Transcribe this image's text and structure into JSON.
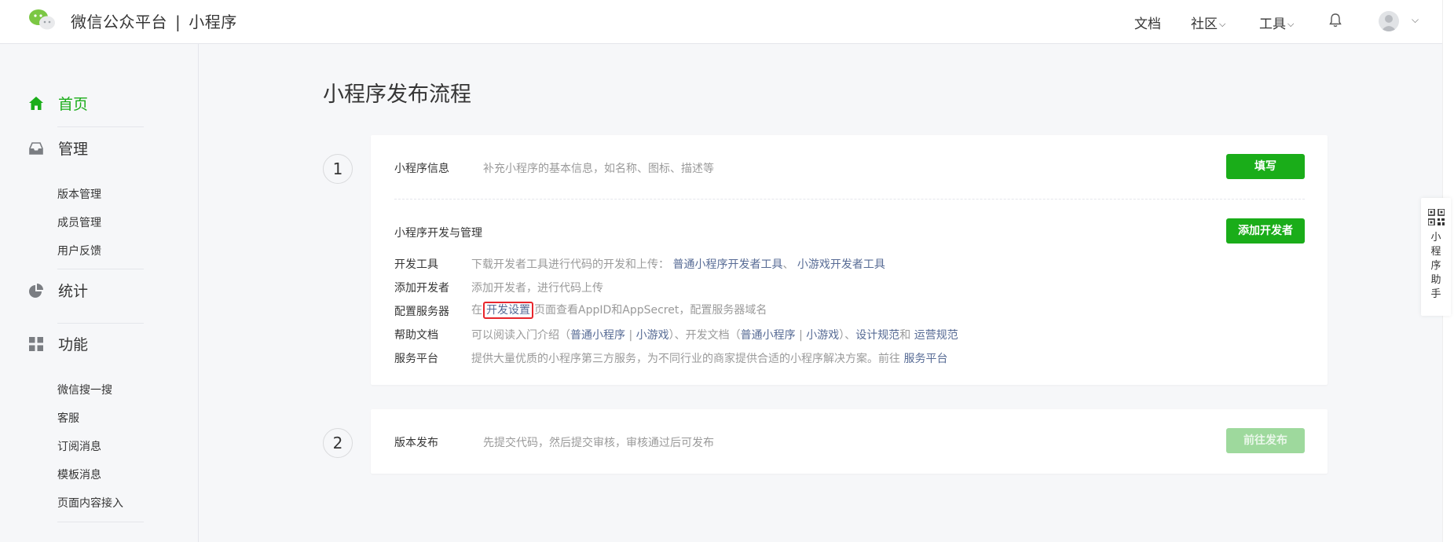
{
  "header": {
    "brand": "微信公众平台",
    "product": "小程序",
    "separator": "|",
    "nav": [
      {
        "label": "文档",
        "has_dropdown": false
      },
      {
        "label": "社区",
        "has_dropdown": true
      },
      {
        "label": "工具",
        "has_dropdown": true
      }
    ],
    "chevron": "⌵"
  },
  "sidebar": {
    "home": {
      "label": "首页",
      "icon": "home-icon"
    },
    "manage": {
      "label": "管理",
      "icon": "inbox-icon",
      "items": [
        "版本管理",
        "成员管理",
        "用户反馈"
      ]
    },
    "stats": {
      "label": "统计",
      "icon": "pie-chart-icon"
    },
    "features": {
      "label": "功能",
      "icon": "grid-icon",
      "items": [
        "微信搜一搜",
        "客服",
        "订阅消息",
        "模板消息",
        "页面内容接入"
      ]
    }
  },
  "main": {
    "title": "小程序发布流程",
    "step1": {
      "number": "1",
      "info_label": "小程序信息",
      "info_desc": "补充小程序的基本信息，如名称、图标、描述等",
      "fill_button": "填写",
      "dev_label": "小程序开发与管理",
      "add_dev_button": "添加开发者",
      "rows": {
        "tools": {
          "label": "开发工具",
          "text": "下载开发者工具进行代码的开发和上传：",
          "link1": "普通小程序开发者工具",
          "sep": "、",
          "link2": "小游戏开发者工具"
        },
        "add_dev": {
          "label": "添加开发者",
          "text": "添加开发者，进行代码上传"
        },
        "server": {
          "label": "配置服务器",
          "pre": "在",
          "link": "开发设置",
          "post": "页面查看AppID和AppSecret，配置服务器域名"
        },
        "docs": {
          "label": "帮助文档",
          "t1": "可以阅读入门介绍（",
          "l1": "普通小程序",
          "bar": "|",
          "l2": "小游戏",
          "t2": "）、开发文档（",
          "l3": "普通小程序",
          "l4": "小游戏",
          "t3": "）、",
          "l5": "设计规范",
          "t4": "和",
          "l6": "运营规范"
        },
        "platform": {
          "label": "服务平台",
          "text": "提供大量优质的小程序第三方服务，为不同行业的商家提供合适的小程序解决方案。前往",
          "link": "服务平台"
        }
      }
    },
    "step2": {
      "number": "2",
      "label": "版本发布",
      "desc": "先提交代码，然后提交审核，审核通过后可发布",
      "button": "前往发布"
    }
  },
  "helper": {
    "text": "小程序助手",
    "icon": "qr-code-icon"
  },
  "colors": {
    "accent": "#1aad19",
    "link": "#576b95",
    "highlight_border": "#e8262c",
    "disabled_button": "#9ed99d"
  }
}
